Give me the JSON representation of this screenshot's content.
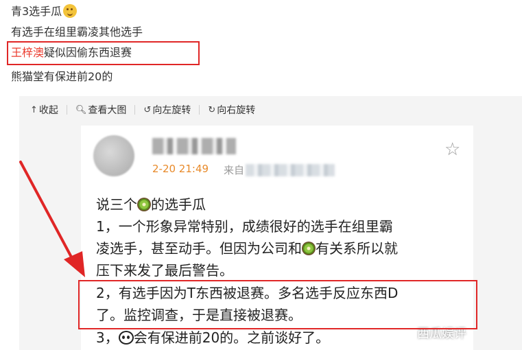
{
  "post": {
    "line1": "青3选手瓜",
    "line1_emoji": "smile-face-emoji",
    "line2": "有选手在组里霸凌其他选手",
    "line3_name": "王梓澳",
    "line3_rest": "疑似因偷东西退赛",
    "line4": "熊猫堂有保进前20的"
  },
  "toolbar": {
    "collapse": "收起",
    "view_large": "查看大图",
    "rotate_left": "向左旋转",
    "rotate_right": "向右旋转"
  },
  "screenshot": {
    "time": "2-20 21:49",
    "source": "来自",
    "lines": [
      {
        "pre": "说三个",
        "emoji": "kiwi",
        "post": "的选手瓜"
      },
      {
        "pre": "1，一个形象异常特别，成绩很好的选手在组里霸"
      },
      {
        "pre": "凌选手，甚至动手。但因为公司和",
        "emoji": "kiwi",
        "post": "有关系所以就"
      },
      {
        "pre": "压下来发了最后警告。"
      },
      {
        "pre": "2，有选手因为T东西被退赛。多名选手反应东西D"
      },
      {
        "pre": "了。监控调查，于是直接被退赛。"
      },
      {
        "pre": "3，",
        "emoji": "panda",
        "post": "会有保进前20的。之前谈好了。"
      }
    ]
  },
  "watermark": "西瓜娱评",
  "colors": {
    "highlight": "#eb3b2e",
    "box": "#e02626",
    "time": "#e88a2a"
  }
}
